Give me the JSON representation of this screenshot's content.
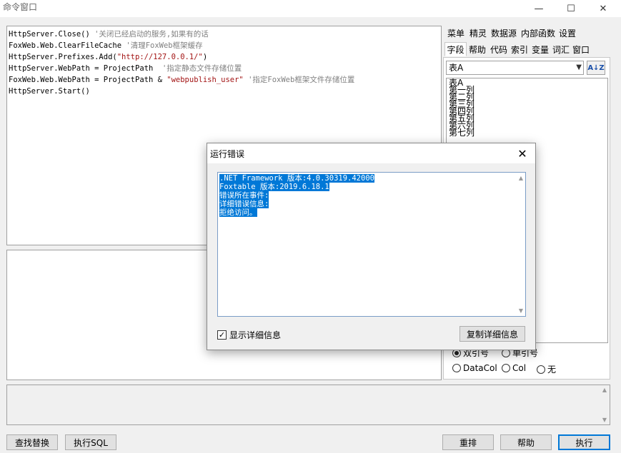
{
  "window": {
    "title": "命令窗口",
    "minimize_glyph": "—",
    "maximize_glyph": "☐",
    "close_glyph": "✕"
  },
  "editor": {
    "lines": [
      {
        "code": "HttpServer.Close() ",
        "string": "",
        "comment": "'关闭已经启动的服务,如果有的话"
      },
      {
        "code": "FoxWeb.Web.ClearFileCache ",
        "string": "",
        "comment": "'清理FoxWeb框架缓存"
      },
      {
        "code": "HttpServer.Prefixes.Add(",
        "string": "\"http://127.0.0.1/\"",
        "tail": ")",
        "comment": ""
      },
      {
        "code": "HttpServer.WebPath = ProjectPath  ",
        "string": "",
        "comment": "'指定静态文件存储位置"
      },
      {
        "code": "FoxWeb.Web.WebPath = ProjectPath & ",
        "string": "\"webpublish_user\"",
        "tail": " ",
        "comment": "'指定FoxWeb框架文件存储位置"
      },
      {
        "code": "HttpServer.Start()",
        "string": "",
        "comment": ""
      }
    ]
  },
  "tabs": {
    "row1": [
      "菜单",
      "精灵",
      "数据源",
      "内部函数",
      "设置"
    ],
    "row2": [
      "字段",
      "帮助",
      "代码",
      "索引",
      "变量",
      "词汇",
      "窗口"
    ],
    "active": "字段"
  },
  "field_panel": {
    "table_select_value": "表A",
    "sort_icon_label": "A↓Z",
    "columns": [
      "表A",
      "第一列",
      "第二列",
      "第三列",
      "第四列",
      "第五列",
      "第六列",
      "第七列"
    ],
    "quote_options": [
      "双引号",
      "单引号"
    ],
    "quote_selected": "双引号",
    "type_options": [
      "DataCol",
      "Col",
      "无"
    ]
  },
  "bottom_buttons": {
    "find_replace": "查找替换",
    "exec_sql": "执行SQL",
    "reorder": "重排",
    "help": "帮助",
    "execute": "执行"
  },
  "dialog": {
    "title": "运行错误",
    "close_glyph": "✕",
    "lines": [
      ".NET Framework 版本:4.0.30319.42000",
      "Foxtable 版本:2019.6.18.1",
      "错误所在事件:",
      "详细错误信息:",
      "拒绝访问。"
    ],
    "show_details_label": "显示详细信息",
    "show_details_checked": true,
    "copy_button": "复制详细信息"
  }
}
